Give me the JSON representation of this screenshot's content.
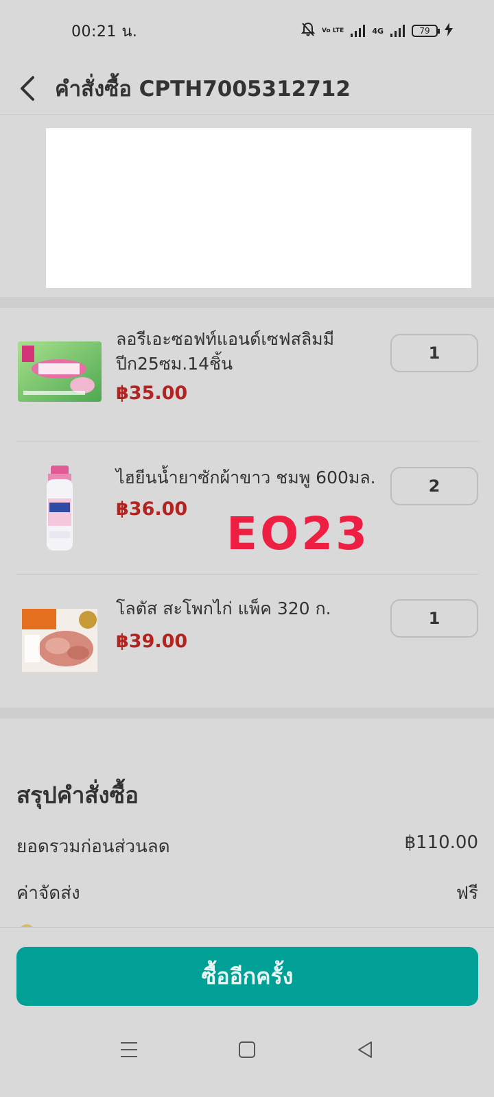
{
  "status_bar": {
    "time": "00:21 น.",
    "battery": "79",
    "network_4g": "4G",
    "volte": "Vo LTE"
  },
  "header": {
    "title": "คำสั่งซื้อ CPTH7005312712"
  },
  "items": [
    {
      "name": "ลอรีเอะซอฟท์แอนด์เซฟสลิมมีปีก25ซม.14ชิ้น",
      "price": "฿35.00",
      "qty": "1",
      "image": "laurier-pads-box"
    },
    {
      "name": "ไฮยีนน้ำยาซักผ้าขาว ชมพู 600มล.",
      "price": "฿36.00",
      "qty": "2",
      "image": "hygiene-bleach-bottle"
    },
    {
      "name": "โลตัส สะโพกไก่ แพ็ค 320 ก.",
      "price": "฿39.00",
      "qty": "1",
      "image": "chicken-thigh-pack"
    }
  ],
  "overlay_code": "EO23",
  "summary": {
    "title": "สรุปคำสั่งซื้อ",
    "subtotal_label": "ยอดรวมก่อนส่วนลด",
    "subtotal_value": "฿110.00",
    "shipping_label": "ค่าจัดส่ง",
    "shipping_value": "ฟรี"
  },
  "actions": {
    "rebuy_label": "ซื้ออีกครั้ง"
  },
  "colors": {
    "accent": "#00a096",
    "price": "#b3231f",
    "overlay": "#ef1f43"
  }
}
